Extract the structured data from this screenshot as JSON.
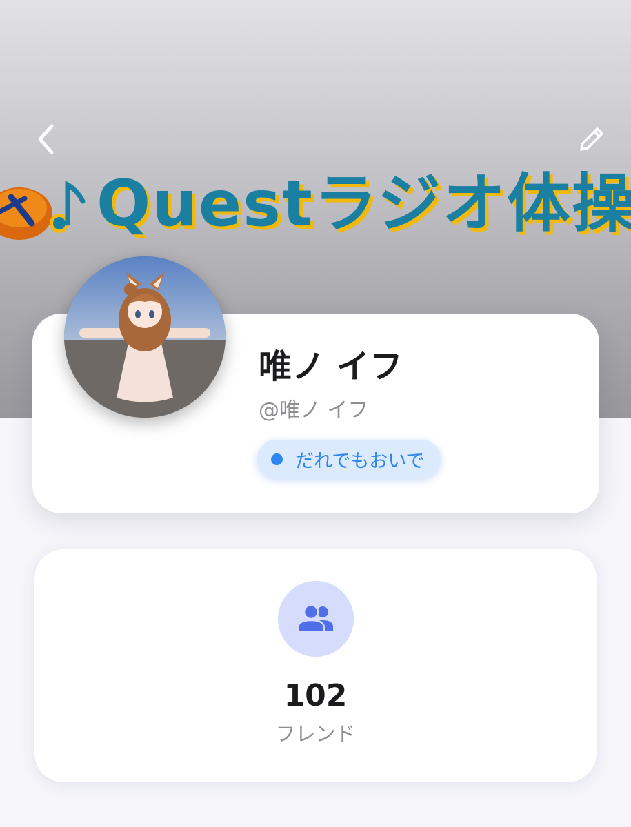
{
  "header": {
    "banner_text": "Questラジオ体操部",
    "back_icon": "chevron-left-icon",
    "edit_icon": "pencil-icon"
  },
  "profile": {
    "display_name": "唯ノ イフ",
    "handle": "@唯ノ イフ",
    "status": {
      "label": "だれでもおいで",
      "color": "#2f86ee"
    }
  },
  "stats": {
    "friends": {
      "icon": "users-icon",
      "count": "102",
      "label": "フレンド"
    }
  },
  "colors": {
    "accent": "#2f86ee",
    "friends_icon": "#4f6fe8",
    "banner_text": "#1a7fa0",
    "banner_text_shadow": "#f0b90b"
  }
}
